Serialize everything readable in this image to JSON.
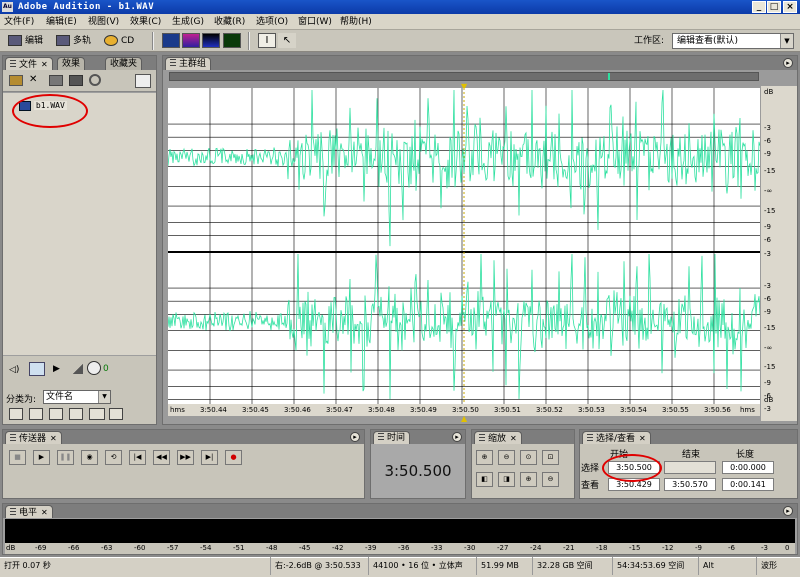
{
  "window": {
    "title": "Adobe Audition - b1.WAV",
    "app_icon_text": "Au",
    "controls": [
      "_",
      "□",
      "×"
    ]
  },
  "menu": [
    "文件(F)",
    "编辑(E)",
    "视图(V)",
    "效果(C)",
    "生成(G)",
    "收藏(R)",
    "选项(O)",
    "窗口(W)",
    "帮助(H)"
  ],
  "toolbar": {
    "modes": [
      "编辑",
      "多轨",
      "CD"
    ],
    "workspace_label": "工作区:",
    "workspace_value": "编辑查看(默认)"
  },
  "files_panel": {
    "tabs": [
      "文件",
      "效果",
      "收藏夹"
    ],
    "file_name": "b1.WAV",
    "volume_value": "0",
    "sort_label": "分类为:",
    "sort_value": "文件名"
  },
  "main_panel": {
    "tab": "主群组",
    "db_scale_top": [
      "dB",
      "-3",
      "-6",
      "-9",
      "-15",
      "-∞",
      "-15",
      "-9",
      "-6",
      "-3"
    ],
    "db_scale_bottom": [
      "-3",
      "-6",
      "-9",
      "-15",
      "-∞",
      "-15",
      "-9",
      "-6",
      "-3",
      "dB"
    ],
    "time_ticks": [
      "hms",
      "3:50.44",
      "3:50.45",
      "3:50.46",
      "3:50.47",
      "3:50.48",
      "3:50.49",
      "3:50.50",
      "3:50.51",
      "3:50.52",
      "3:50.53",
      "3:50.54",
      "3:50.55",
      "3:50.56",
      "hms"
    ]
  },
  "transport_panel": {
    "tab": "传送器"
  },
  "time_panel": {
    "tab": "时间",
    "value": "3:50.500"
  },
  "zoom_panel": {
    "tab": "缩放"
  },
  "selection_panel": {
    "tab": "选择/查看",
    "headers": [
      "开始",
      "结束",
      "长度"
    ],
    "rows": [
      {
        "label": "选择",
        "start": "3:50.500",
        "end": "",
        "length": "0:00.000"
      },
      {
        "label": "查看",
        "start": "3:50.429",
        "end": "3:50.570",
        "length": "0:00.141"
      }
    ]
  },
  "level_panel": {
    "tab": "电平",
    "scale": [
      "dB",
      "-69",
      "-66",
      "-63",
      "-60",
      "-57",
      "-54",
      "-51",
      "-48",
      "-45",
      "-42",
      "-39",
      "-36",
      "-33",
      "-30",
      "-27",
      "-24",
      "-21",
      "-18",
      "-15",
      "-12",
      "-9",
      "-6",
      "-3",
      "0"
    ]
  },
  "status": {
    "left": "打开 0.07 秒",
    "cursor": "右:-2.6dB @  3:50.533",
    "format": "44100 • 16 位 • 立体声",
    "size": "51.99 MB",
    "disk": "32.28 GB 空间",
    "time_free": "54:34:53.69 空间",
    "key": "Alt",
    "view": "波形"
  },
  "colors": {
    "waveform": "#2ee0a0",
    "title_bar": "#0c3aa8",
    "annotation": "#e00000"
  }
}
